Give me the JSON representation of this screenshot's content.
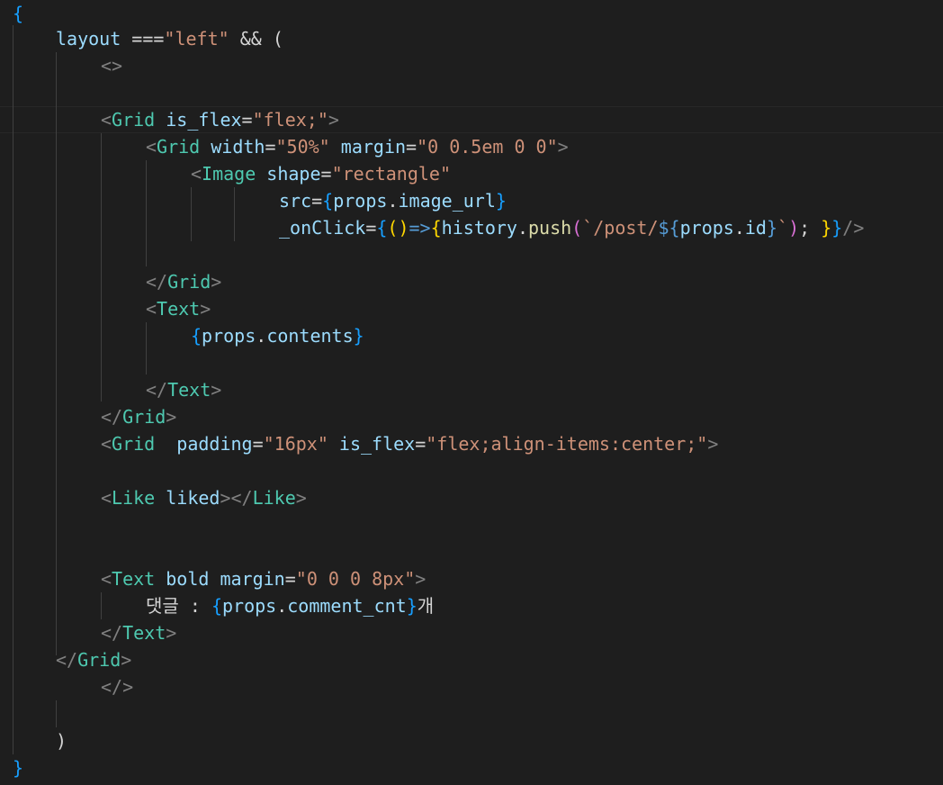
{
  "editor": {
    "language": "jsx",
    "colors": {
      "background": "#1e1e1e",
      "tag": "#4ec9b0",
      "attribute": "#9cdcfe",
      "string": "#ce9178",
      "punctuation": "#808080",
      "function": "#dcdcaa",
      "bracket_gold": "#ffd700",
      "bracket_blue": "#179fff",
      "bracket_purple": "#da70d6"
    },
    "lines": [
      {
        "tokens": [
          {
            "t": "{",
            "c": "brace3"
          }
        ]
      },
      {
        "tokens": [
          {
            "t": "layout",
            "c": "var"
          },
          {
            "t": " ===",
            "c": "op"
          },
          {
            "t": "\"left\"",
            "c": "str"
          },
          {
            "t": " && ",
            "c": "op"
          },
          {
            "t": "(",
            "c": "op"
          }
        ]
      },
      {
        "tokens": [
          {
            "t": "<>",
            "c": "punct"
          }
        ]
      },
      {
        "tokens": []
      },
      {
        "tokens": [
          {
            "t": "<",
            "c": "punct"
          },
          {
            "t": "Grid",
            "c": "tag"
          },
          {
            "t": " is_flex",
            "c": "attr"
          },
          {
            "t": "=",
            "c": "op"
          },
          {
            "t": "\"flex;\"",
            "c": "str"
          },
          {
            "t": ">",
            "c": "punct"
          }
        ]
      },
      {
        "tokens": [
          {
            "t": "<",
            "c": "punct"
          },
          {
            "t": "Grid",
            "c": "tag"
          },
          {
            "t": " width",
            "c": "attr"
          },
          {
            "t": "=",
            "c": "op"
          },
          {
            "t": "\"50%\"",
            "c": "str"
          },
          {
            "t": " margin",
            "c": "attr"
          },
          {
            "t": "=",
            "c": "op"
          },
          {
            "t": "\"0 0.5em 0 0\"",
            "c": "str"
          },
          {
            "t": ">",
            "c": "punct"
          }
        ]
      },
      {
        "tokens": [
          {
            "t": "<",
            "c": "punct"
          },
          {
            "t": "Image",
            "c": "tag"
          },
          {
            "t": " shape",
            "c": "attr"
          },
          {
            "t": "=",
            "c": "op"
          },
          {
            "t": "\"rectangle\"",
            "c": "str"
          }
        ]
      },
      {
        "tokens": [
          {
            "t": "src",
            "c": "attr"
          },
          {
            "t": "=",
            "c": "op"
          },
          {
            "t": "{",
            "c": "brace3"
          },
          {
            "t": "props",
            "c": "var"
          },
          {
            "t": ".",
            "c": "op"
          },
          {
            "t": "image_url",
            "c": "var"
          },
          {
            "t": "}",
            "c": "brace3"
          }
        ]
      },
      {
        "tokens": [
          {
            "t": "_onClick",
            "c": "attr"
          },
          {
            "t": "=",
            "c": "op"
          },
          {
            "t": "{",
            "c": "brace3"
          },
          {
            "t": "()",
            "c": "brace1"
          },
          {
            "t": "=>",
            "c": "kw"
          },
          {
            "t": "{",
            "c": "brace1"
          },
          {
            "t": "history",
            "c": "var"
          },
          {
            "t": ".",
            "c": "op"
          },
          {
            "t": "push",
            "c": "fn"
          },
          {
            "t": "(",
            "c": "brace2"
          },
          {
            "t": "`/post/",
            "c": "str"
          },
          {
            "t": "${",
            "c": "kw"
          },
          {
            "t": "props",
            "c": "var"
          },
          {
            "t": ".",
            "c": "op"
          },
          {
            "t": "id",
            "c": "var"
          },
          {
            "t": "}",
            "c": "kw"
          },
          {
            "t": "`",
            "c": "str"
          },
          {
            "t": ")",
            "c": "brace2"
          },
          {
            "t": "; ",
            "c": "op"
          },
          {
            "t": "}",
            "c": "brace1"
          },
          {
            "t": "}",
            "c": "brace3"
          },
          {
            "t": "/>",
            "c": "punct"
          }
        ]
      },
      {
        "tokens": []
      },
      {
        "tokens": [
          {
            "t": "</",
            "c": "punct"
          },
          {
            "t": "Grid",
            "c": "tag"
          },
          {
            "t": ">",
            "c": "punct"
          }
        ]
      },
      {
        "tokens": [
          {
            "t": "<",
            "c": "punct"
          },
          {
            "t": "Text",
            "c": "tag"
          },
          {
            "t": ">",
            "c": "punct"
          }
        ]
      },
      {
        "tokens": [
          {
            "t": "{",
            "c": "brace3"
          },
          {
            "t": "props",
            "c": "var"
          },
          {
            "t": ".",
            "c": "op"
          },
          {
            "t": "contents",
            "c": "var"
          },
          {
            "t": "}",
            "c": "brace3"
          }
        ]
      },
      {
        "tokens": []
      },
      {
        "tokens": [
          {
            "t": "</",
            "c": "punct"
          },
          {
            "t": "Text",
            "c": "tag"
          },
          {
            "t": ">",
            "c": "punct"
          }
        ]
      },
      {
        "tokens": [
          {
            "t": "</",
            "c": "punct"
          },
          {
            "t": "Grid",
            "c": "tag"
          },
          {
            "t": ">",
            "c": "punct"
          }
        ]
      },
      {
        "tokens": [
          {
            "t": "<",
            "c": "punct"
          },
          {
            "t": "Grid",
            "c": "tag"
          },
          {
            "t": "  padding",
            "c": "attr"
          },
          {
            "t": "=",
            "c": "op"
          },
          {
            "t": "\"16px\"",
            "c": "str"
          },
          {
            "t": " is_flex",
            "c": "attr"
          },
          {
            "t": "=",
            "c": "op"
          },
          {
            "t": "\"flex;align-items:center;\"",
            "c": "str"
          },
          {
            "t": ">",
            "c": "punct"
          }
        ]
      },
      {
        "tokens": []
      },
      {
        "tokens": [
          {
            "t": "<",
            "c": "punct"
          },
          {
            "t": "Like",
            "c": "tag"
          },
          {
            "t": " liked",
            "c": "attr"
          },
          {
            "t": "></",
            "c": "punct"
          },
          {
            "t": "Like",
            "c": "tag"
          },
          {
            "t": ">",
            "c": "punct"
          }
        ]
      },
      {
        "tokens": []
      },
      {
        "tokens": []
      },
      {
        "tokens": [
          {
            "t": "<",
            "c": "punct"
          },
          {
            "t": "Text",
            "c": "tag"
          },
          {
            "t": " bold",
            "c": "attr"
          },
          {
            "t": " margin",
            "c": "attr"
          },
          {
            "t": "=",
            "c": "op"
          },
          {
            "t": "\"0 0 0 8px\"",
            "c": "str"
          },
          {
            "t": ">",
            "c": "punct"
          }
        ]
      },
      {
        "tokens": [
          {
            "t": "댓글 : ",
            "c": "text"
          },
          {
            "t": "{",
            "c": "brace3"
          },
          {
            "t": "props",
            "c": "var"
          },
          {
            "t": ".",
            "c": "op"
          },
          {
            "t": "comment_cnt",
            "c": "var"
          },
          {
            "t": "}",
            "c": "brace3"
          },
          {
            "t": "개",
            "c": "text"
          }
        ]
      },
      {
        "tokens": [
          {
            "t": "</",
            "c": "punct"
          },
          {
            "t": "Text",
            "c": "tag"
          },
          {
            "t": ">",
            "c": "punct"
          }
        ]
      },
      {
        "tokens": [
          {
            "t": "</",
            "c": "punct"
          },
          {
            "t": "Grid",
            "c": "tag"
          },
          {
            "t": ">",
            "c": "punct"
          }
        ]
      },
      {
        "tokens": [
          {
            "t": "</>",
            "c": "punct"
          }
        ]
      },
      {
        "tokens": []
      },
      {
        "tokens": [
          {
            "t": ")",
            "c": "op"
          }
        ]
      },
      {
        "tokens": [
          {
            "t": "}",
            "c": "brace3"
          }
        ]
      }
    ]
  }
}
